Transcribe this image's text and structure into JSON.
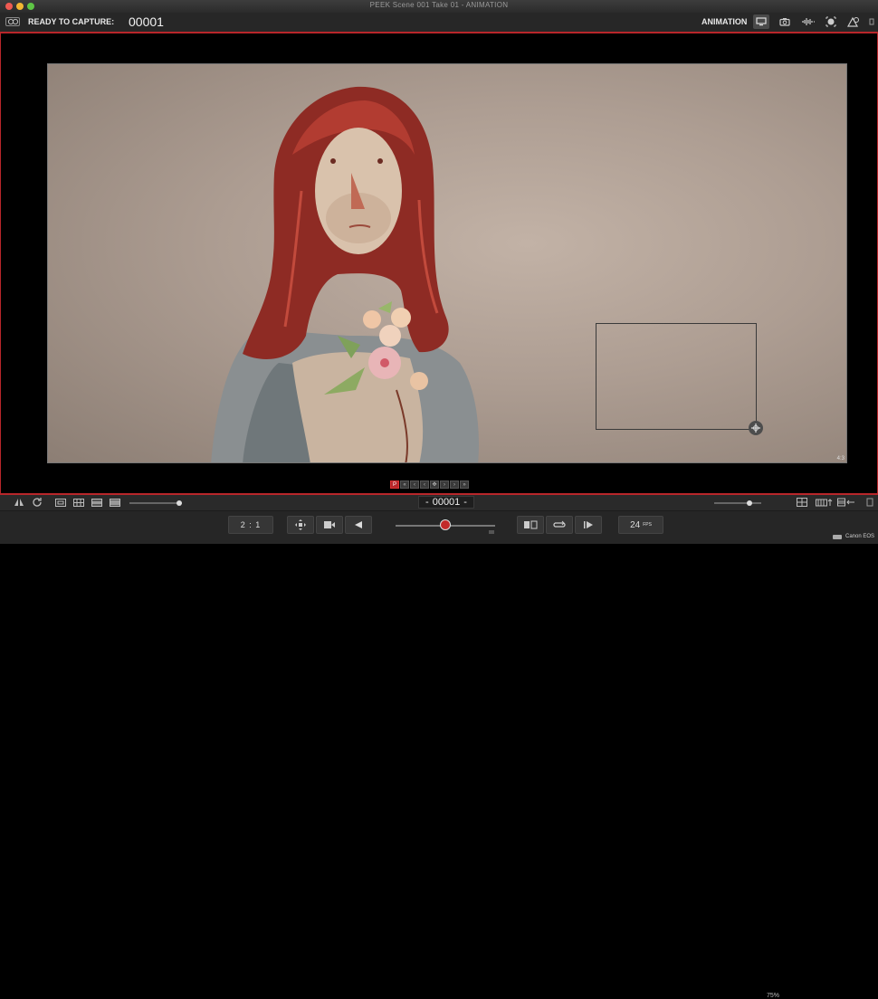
{
  "window": {
    "title": "PEEK  Scene 001  Take 01 - ANIMATION"
  },
  "toolbar": {
    "status_label": "READY TO CAPTURE:",
    "frame_counter": "00001",
    "mode_label": "ANIMATION",
    "icons": [
      "monitor-icon",
      "camera-icon",
      "audio-waveform-icon",
      "focus-icon",
      "overlay-shapes-icon"
    ]
  },
  "viewport": {
    "image_description_only": false,
    "corner_mark": "4:3"
  },
  "frame_nav": {
    "buttons": [
      "P",
      "«",
      "‹",
      "‹",
      "✥",
      "›",
      "›",
      "»"
    ]
  },
  "bottombar": {
    "frame_counter": {
      "minus": "-",
      "value": "00001",
      "plus": "-"
    },
    "zoom": "75%",
    "opacity_level": 0.95,
    "zoom_level": 0.75
  },
  "playback": {
    "ratio": "2 : 1",
    "fps_value": "24",
    "fps_unit": "FPS",
    "scrub_level": 0.5
  },
  "camera": {
    "label": "Canon EOS"
  },
  "colors": {
    "accent": "#b8262a",
    "background": "#000000",
    "toolbar": "#272727"
  }
}
